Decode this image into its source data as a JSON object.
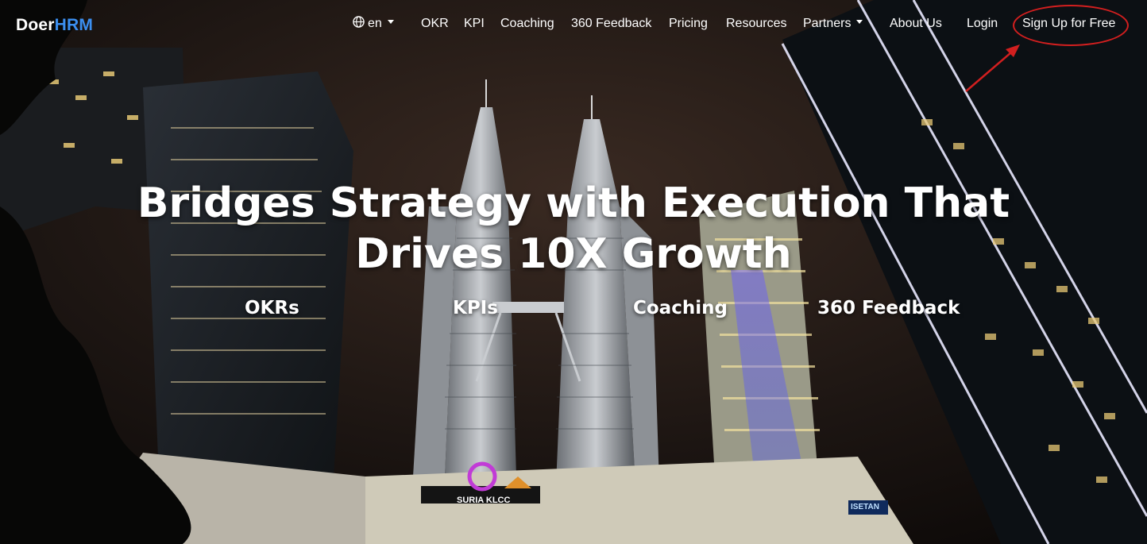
{
  "brand": {
    "part1": "Doer",
    "part2": "HRM",
    "accent": "#3b8ff0"
  },
  "nav": {
    "language": "en",
    "items": [
      "OKR",
      "KPI",
      "Coaching",
      "360 Feedback",
      "Pricing",
      "Resources",
      "Partners",
      "About Us",
      "Login",
      "Sign Up for Free"
    ]
  },
  "hero": {
    "headline_line1": "Bridges Strategy with Execution That",
    "headline_line2": "Drives 10X Growth",
    "features": [
      "OKRs",
      "KPIs",
      "Coaching",
      "360 Feedback"
    ]
  },
  "annotation": {
    "color": "#d21f1f"
  },
  "signage": {
    "mall": "SURIA KLCC",
    "store": "ISETAN"
  }
}
